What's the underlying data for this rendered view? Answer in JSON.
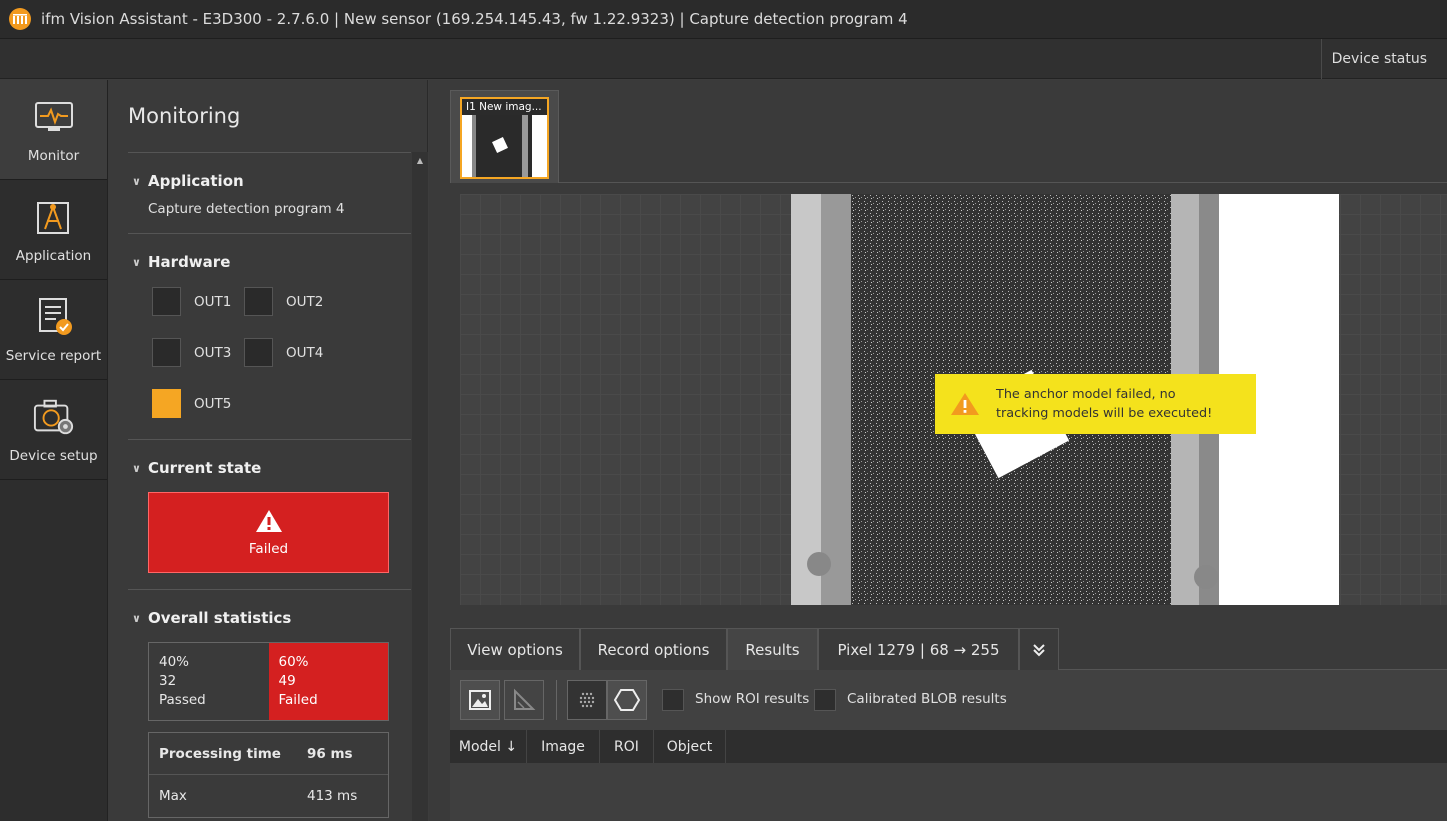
{
  "window": {
    "title": "ifm Vision Assistant - E3D300 - 2.7.6.0 | New sensor (169.254.145.43, fw 1.22.9323) | Capture detection program 4",
    "logo_text": "ifm"
  },
  "toolbar": {
    "device_status_label": "Device status"
  },
  "leftnav": {
    "items": [
      {
        "label": "Monitor",
        "icon": "monitor-icon"
      },
      {
        "label": "Application",
        "icon": "compass-icon"
      },
      {
        "label": "Service report",
        "icon": "report-icon"
      },
      {
        "label": "Device setup",
        "icon": "camera-gear-icon"
      }
    ]
  },
  "monitoring": {
    "title": "Monitoring",
    "application": {
      "heading": "Application",
      "name": "Capture detection program 4"
    },
    "hardware": {
      "heading": "Hardware",
      "outputs": [
        {
          "label": "OUT1",
          "on": false
        },
        {
          "label": "OUT2",
          "on": false
        },
        {
          "label": "OUT3",
          "on": false
        },
        {
          "label": "OUT4",
          "on": false
        },
        {
          "label": "OUT5",
          "on": true
        }
      ]
    },
    "current_state": {
      "heading": "Current state",
      "value": "Failed",
      "color": "#d42020"
    },
    "overall_statistics": {
      "heading": "Overall statistics",
      "passed": {
        "percent": "40%",
        "count": "32",
        "label": "Passed"
      },
      "failed": {
        "percent": "60%",
        "count": "49",
        "label": "Failed"
      },
      "processing_time_label": "Processing time",
      "processing_time_value": "96 ms",
      "max_label": "Max",
      "max_value": "413 ms"
    }
  },
  "image_tabs": [
    {
      "label": "I1 New imag..."
    }
  ],
  "viewer": {
    "warning": "The anchor model failed, no tracking models will be executed!"
  },
  "bottom_tabs": {
    "view_options": "View options",
    "record_options": "Record options",
    "results": "Results",
    "pixel_readout": "Pixel 1279 |   68 → 255"
  },
  "results_toolbar": {
    "show_roi_results": "Show ROI results",
    "calibrated_blob_results": "Calibrated BLOB results"
  },
  "results_grid": {
    "columns": [
      "Model ↓",
      "Image",
      "ROI",
      "Object"
    ]
  },
  "colors": {
    "accent": "#f5a623",
    "failed": "#d42020",
    "warning": "#f4e21c"
  }
}
